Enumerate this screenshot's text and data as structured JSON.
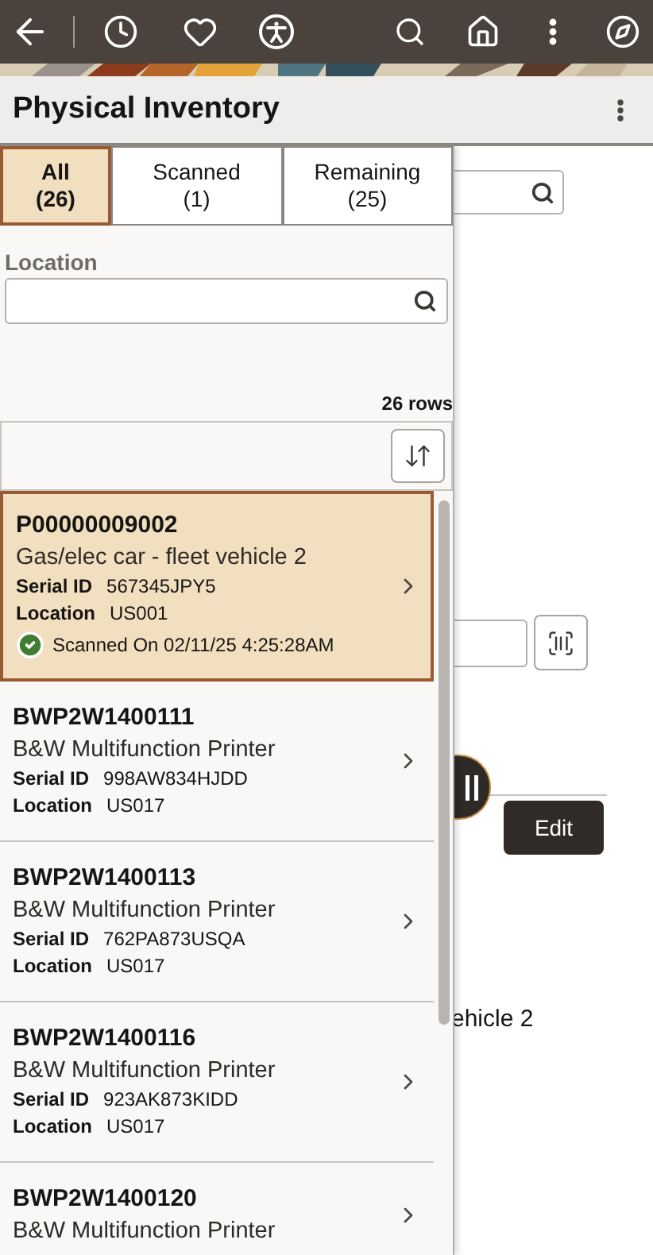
{
  "page": {
    "title": "Physical Inventory"
  },
  "tabs": [
    {
      "label": "All",
      "count": "(26)",
      "selected": true
    },
    {
      "label": "Scanned",
      "count": "(1)",
      "selected": false
    },
    {
      "label": "Remaining",
      "count": "(25)",
      "selected": false
    }
  ],
  "location_filter": {
    "label": "Location"
  },
  "row_count": "26 rows",
  "items": [
    {
      "id": "P00000009002",
      "description": "Gas/elec car - fleet vehicle 2",
      "serial_label": "Serial ID",
      "serial": "567345JPY5",
      "location_label": "Location",
      "location": "US001",
      "scanned": "Scanned On 02/11/25 4:25:28AM",
      "selected": true
    },
    {
      "id": "BWP2W1400111",
      "description": "B&W Multifunction Printer",
      "serial_label": "Serial ID",
      "serial": "998AW834HJDD",
      "location_label": "Location",
      "location": "US017",
      "selected": false
    },
    {
      "id": "BWP2W1400113",
      "description": "B&W Multifunction Printer",
      "serial_label": "Serial ID",
      "serial": "762PA873USQA",
      "location_label": "Location",
      "location": "US017",
      "selected": false
    },
    {
      "id": "BWP2W1400116",
      "description": "B&W Multifunction Printer",
      "serial_label": "Serial ID",
      "serial": "923AK873KIDD",
      "location_label": "Location",
      "location": "US017",
      "selected": false
    },
    {
      "id": "BWP2W1400120",
      "description": "B&W Multifunction Printer",
      "selected": false
    }
  ],
  "detail": {
    "edit_button": "Edit",
    "description_fragment": "ehicle 2"
  }
}
